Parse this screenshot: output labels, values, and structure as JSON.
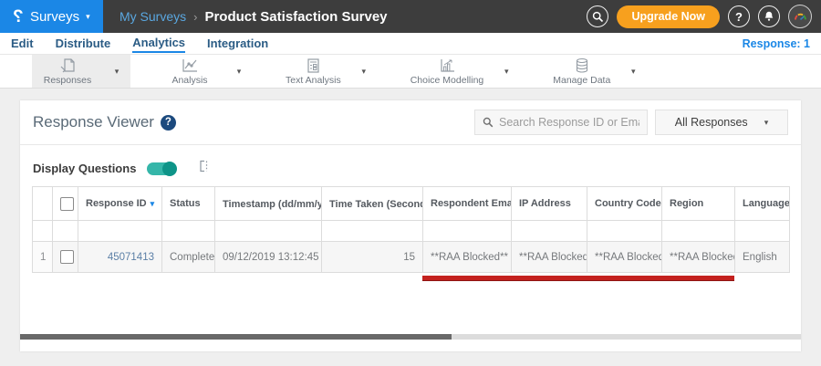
{
  "glyphs": {
    "logo": "?",
    "caret_down": "▾",
    "breadcrumb_separator": "›",
    "help": "?",
    "sort_updown": "⇅"
  },
  "colors": {
    "accent_blue": "#1b87e6",
    "topbar_dark": "#3d3d3d",
    "upgrade_orange": "#f7a01e",
    "toggle_teal": "#0e9488",
    "annotation_red": "#c4211e"
  },
  "topbar": {
    "app_menu_label": "Surveys",
    "breadcrumb": {
      "parent": "My Surveys",
      "current": "Product Satisfaction Survey"
    },
    "upgrade_label": "Upgrade Now"
  },
  "nav": {
    "items": [
      {
        "label": "Edit"
      },
      {
        "label": "Distribute"
      },
      {
        "label": "Analytics"
      },
      {
        "label": "Integration"
      }
    ],
    "response_count_label": "Response: 1"
  },
  "toolbar": {
    "groups": [
      {
        "label": "Responses"
      },
      {
        "label": "Analysis"
      },
      {
        "label": "Text Analysis"
      },
      {
        "label": "Choice Modelling"
      },
      {
        "label": "Manage Data"
      }
    ]
  },
  "viewer": {
    "title": "Response Viewer",
    "search_placeholder": "Search Response ID or Email",
    "filter_dropdown_value": "All Responses",
    "display_questions_label": "Display Questions",
    "display_questions_on": true
  },
  "table": {
    "headers": {
      "response_id": "Response ID",
      "status": "Status",
      "timestamp": "Timestamp (dd/mm/yyyy)",
      "time_taken": "Time Taken (Seconds)",
      "respondent_email": "Respondent Email",
      "ip_address": "IP Address",
      "country_code": "Country Code",
      "region": "Region",
      "language": "Language"
    },
    "rows": [
      {
        "index": "1",
        "response_id": "45071413",
        "status": "Completed",
        "timestamp": "09/12/2019 13:12:45",
        "time_taken": "15",
        "respondent_email": "**RAA Blocked**",
        "ip_address": "**RAA Blocked**",
        "country_code": "**RAA Blocked**",
        "region": "**RAA Blocked**",
        "language": "English"
      }
    ]
  }
}
